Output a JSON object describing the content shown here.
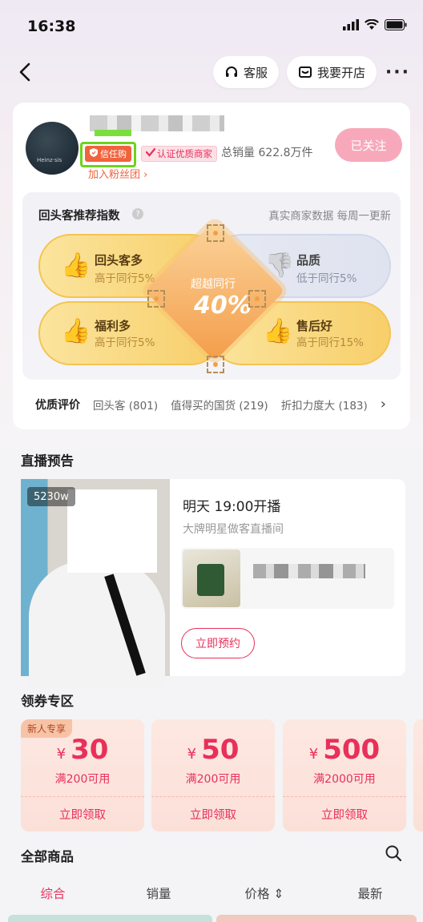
{
  "status_bar": {
    "time": "16:38"
  },
  "nav": {
    "service_label": "客服",
    "open_store_label": "我要开店",
    "more": "···"
  },
  "store": {
    "avatar_text": "Heinz·sis",
    "trust_badge": "信任购",
    "cert_badge": "认证优质商家",
    "sales": "总销量 622.8万件",
    "fans_link": "加入粉丝团 ›",
    "follow_label": "已关注"
  },
  "index_panel": {
    "title": "回头客推荐指数",
    "note": "真实商家数据 每周一更新",
    "center_label": "超越同行",
    "center_value": "40%",
    "items": [
      {
        "label": "回头客多",
        "sub": "高于同行5%"
      },
      {
        "label": "品质",
        "sub": "低于同行5%"
      },
      {
        "label": "福利多",
        "sub": "高于同行5%"
      },
      {
        "label": "售后好",
        "sub": "高于同行15%"
      }
    ]
  },
  "reviews": {
    "lead": "优质评价",
    "tags": [
      "回头客 (801)",
      "值得买的国货 (219)",
      "折扣力度大 (183)"
    ],
    "arrow": "›"
  },
  "live": {
    "section_title": "直播预告",
    "viewers": "5230w",
    "time": "明天 19:00开播",
    "desc": "大牌明星做客直播间",
    "reserve_label": "立即预约"
  },
  "coupons": {
    "section_title": "领券专区",
    "new_tag": "新人专享",
    "currency": "¥",
    "items": [
      {
        "amount": "30",
        "condition": "满200可用",
        "action": "立即领取"
      },
      {
        "amount": "50",
        "condition": "满200可用",
        "action": "立即领取"
      },
      {
        "amount": "500",
        "condition": "满2000可用",
        "action": "立即领取"
      }
    ]
  },
  "goods": {
    "section_title": "全部商品",
    "tabs": [
      "综合",
      "销量",
      "价格 ⇕",
      "最新"
    ]
  },
  "colors": {
    "accent": "#e8305a",
    "gold": "#f7cf6a",
    "trust": "#f0633c",
    "highlight": "#6ed31c"
  }
}
